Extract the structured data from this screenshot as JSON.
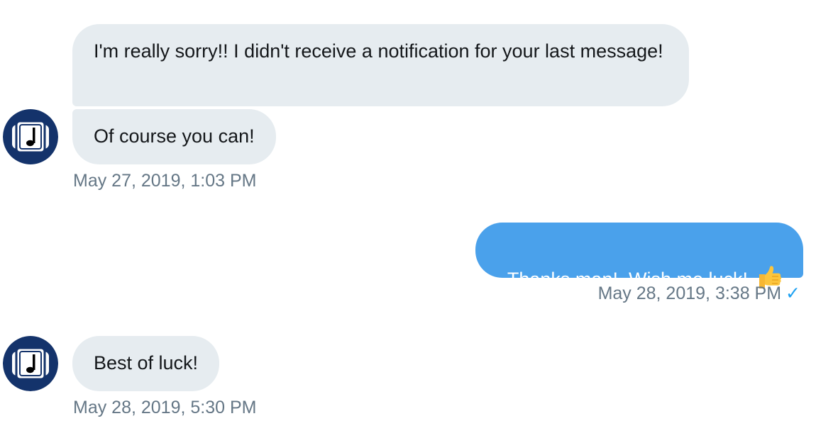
{
  "conversation": {
    "messages": [
      {
        "sender": "other",
        "text": "I'm really sorry!! I didn't receive a notification for your last message!"
      },
      {
        "sender": "other",
        "text": "Of course you can!",
        "timestamp": "May 27, 2019, 1:03 PM"
      },
      {
        "sender": "me",
        "text": "Thanks man!  Wish me luck!",
        "emoji": "thumbs-up",
        "timestamp": "May 28, 2019, 3:38 PM",
        "status_icon": "read-check-icon"
      },
      {
        "sender": "other",
        "text": "Best of luck!",
        "timestamp": "May 28, 2019, 5:30 PM"
      }
    ]
  },
  "avatar": {
    "icon": "music-note-logo-icon"
  },
  "colors": {
    "received_bubble": "#e6ecf0",
    "sent_bubble": "#4aa1eb",
    "timestamp_text": "#657786",
    "avatar_navy": "#14336b",
    "read_check": "#1da1f2"
  }
}
